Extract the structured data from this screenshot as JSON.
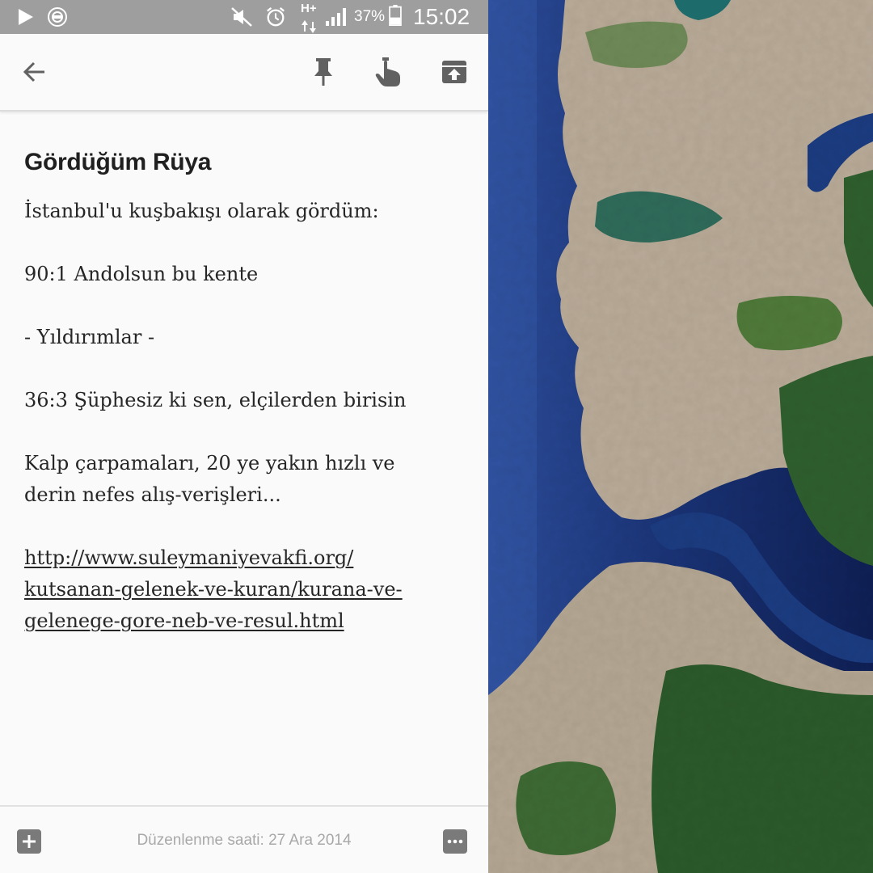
{
  "status_bar": {
    "battery_percent": "37%",
    "time": "15:02",
    "network": "H+",
    "icons": [
      "play-icon",
      "notification-icon",
      "mute-icon",
      "alarm-icon",
      "signal-icon",
      "battery-icon"
    ]
  },
  "toolbar": {
    "icons": [
      "back-arrow-icon",
      "pin-icon",
      "reminder-icon",
      "archive-icon"
    ]
  },
  "note": {
    "title": "Gördüğüm Rüya",
    "lines": [
      "İstanbul'u kuşbakışı olarak gördüm:",
      "",
      "90:1 Andolsun bu kente",
      "",
      "- Yıldırımlar -",
      "",
      "36:3 Şüphesiz ki sen, elçilerden birisin",
      "",
      "Kalp çarpamaları, 20 ye yakın hızlı ve",
      "derin nefes alış-verişleri...",
      ""
    ],
    "link_lines": [
      "http://www.suleymaniyevakfi.org/",
      "kutsanan-gelenek-ve-kuran/kurana-ve-",
      "gelenege-gore-neb-ve-resul.html"
    ]
  },
  "bottom_bar": {
    "edited_text": "Düzenlenme saati: 27 Ara 2014",
    "icons": [
      "add-icon",
      "more-icon"
    ]
  },
  "colors": {
    "status_bar": "#9e9e9e",
    "background": "#fafafa",
    "icon": "#616161",
    "text": "#262626",
    "sea": "#1f3d87",
    "land": "#b7aa98",
    "forest": "#2f5f2e"
  }
}
